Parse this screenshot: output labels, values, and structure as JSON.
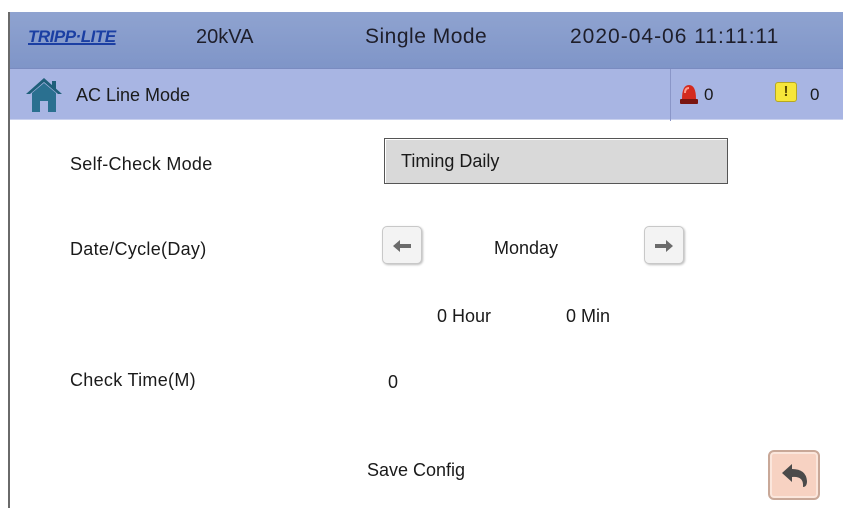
{
  "header": {
    "logo_text": "TRIPP·LITE",
    "capacity": "20kVA",
    "mode": "Single Mode",
    "datetime": "2020-04-06 11:11:11"
  },
  "status": {
    "line_mode": "AC Line Mode",
    "alarm_count": "0",
    "warning_count": "0",
    "warning_glyph": "!",
    "icons": {
      "home": "home-icon",
      "alarm": "alarm-beacon-icon",
      "warning": "warning-icon"
    }
  },
  "form": {
    "self_check_label": "Self-Check Mode",
    "self_check_value": "Timing Daily",
    "date_cycle_label": "Date/Cycle(Day)",
    "day_value": "Monday",
    "hour_value": "0 Hour",
    "min_value": "0 Min",
    "check_time_label": "Check Time(M)",
    "check_time_value": "0"
  },
  "actions": {
    "save_label": "Save Config",
    "back_icon": "back-arrow-icon",
    "prev_icon": "arrow-left-icon",
    "next_icon": "arrow-right-icon"
  },
  "colors": {
    "topbar": "#8fa3d0",
    "statusbar": "#a8b5e3",
    "logo": "#1b3fa3",
    "back_button": "#f7d2c2"
  }
}
